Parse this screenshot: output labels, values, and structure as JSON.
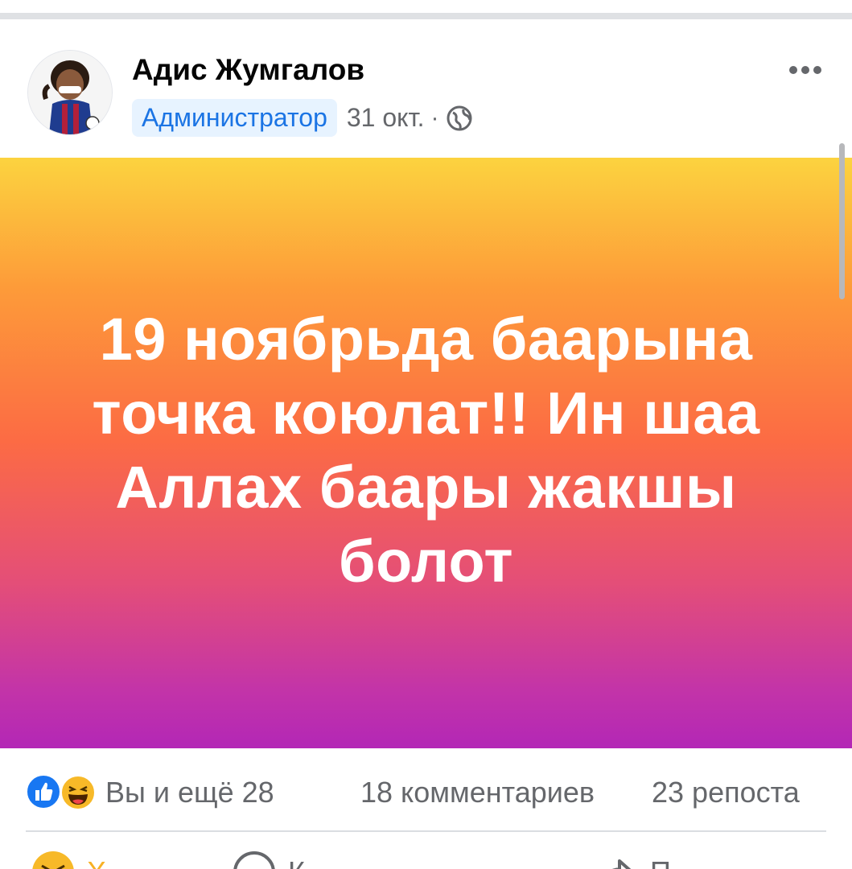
{
  "post": {
    "author": "Адис Жумгалов",
    "role": "Администратор",
    "date": "31 окт.",
    "separator": "·",
    "privacy_icon": "globe-icon",
    "text": "19 ноябрьда баарына точка коюлат!! Ин шаа Аллах баары жакшы болот",
    "background_gradient": [
      "#fcd33f",
      "#fd9b39",
      "#fc6b44",
      "#e44e78",
      "#b327b6"
    ]
  },
  "stats": {
    "reactions": "Вы и ещё 28",
    "comments": "18 комментариев",
    "shares": "23 репоста",
    "reaction_icons": [
      "like-icon",
      "haha-icon"
    ]
  },
  "actions": [
    {
      "label": "Х",
      "icon": "haha-icon"
    },
    {
      "label": "К",
      "icon": "comment-icon"
    },
    {
      "label": "П",
      "icon": "share-icon"
    }
  ],
  "colors": {
    "accent": "#1b74e4",
    "muted": "#65676b",
    "badge_bg": "#e7f3ff"
  }
}
